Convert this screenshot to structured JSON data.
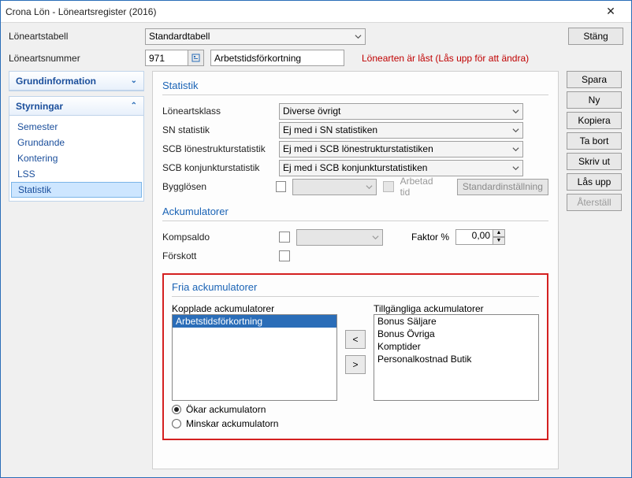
{
  "window": {
    "title": "Crona Lön - Löneartsregister (2016)",
    "close": "✕"
  },
  "top": {
    "tabell_label": "Löneartstabell",
    "tabell_value": "Standardtabell",
    "close_btn": "Stäng",
    "nummer_label": "Löneartsnummer",
    "nummer_value": "971",
    "namn_value": "Arbetstidsförkortning",
    "lock_msg": "Lönearten är låst (Lås upp för att ändra)"
  },
  "sidebar": {
    "grund_header": "Grundinformation",
    "styr_header": "Styrningar",
    "items": [
      "Semester",
      "Grundande",
      "Kontering",
      "LSS",
      "Statistik"
    ]
  },
  "stat": {
    "heading": "Statistik",
    "rows": {
      "loneartsklass": {
        "label": "Löneartsklass",
        "value": "Diverse övrigt"
      },
      "sn": {
        "label": "SN statistik",
        "value": "Ej med i SN statistiken"
      },
      "scb_lon": {
        "label": "SCB lönestrukturstatistik",
        "value": "Ej med i SCB lönestrukturstatistiken"
      },
      "scb_konj": {
        "label": "SCB konjunkturstatistik",
        "value": "Ej med i SCB konjunkturstatistiken"
      },
      "bygg": {
        "label": "Bygglösen",
        "arbetad": "Arbetad tid",
        "std_btn": "Standardinställning"
      }
    }
  },
  "ack": {
    "heading": "Ackumulatorer",
    "komp": {
      "label": "Kompsaldo",
      "faktor_label": "Faktor %",
      "faktor_value": "0,00"
    },
    "forskott": {
      "label": "Förskott"
    }
  },
  "fria": {
    "heading": "Fria ackumulatorer",
    "kopplade_label": "Kopplade ackumulatorer",
    "kopplade_items": [
      "Arbetstidsförkortning"
    ],
    "tillgangliga_label": "Tillgängliga ackumulatorer",
    "tillgangliga_items": [
      "Bonus Säljare",
      "Bonus Övriga",
      "Komptider",
      "Personalkostnad Butik"
    ],
    "radio_okar": "Ökar ackumulatorn",
    "radio_minskar": "Minskar ackumulatorn"
  },
  "buttons": {
    "spara": "Spara",
    "ny": "Ny",
    "kopiera": "Kopiera",
    "tabort": "Ta bort",
    "skrivut": "Skriv ut",
    "lasupp": "Lås upp",
    "aterstall": "Återställ"
  },
  "icons": {
    "move_left": "<",
    "move_right": ">"
  }
}
